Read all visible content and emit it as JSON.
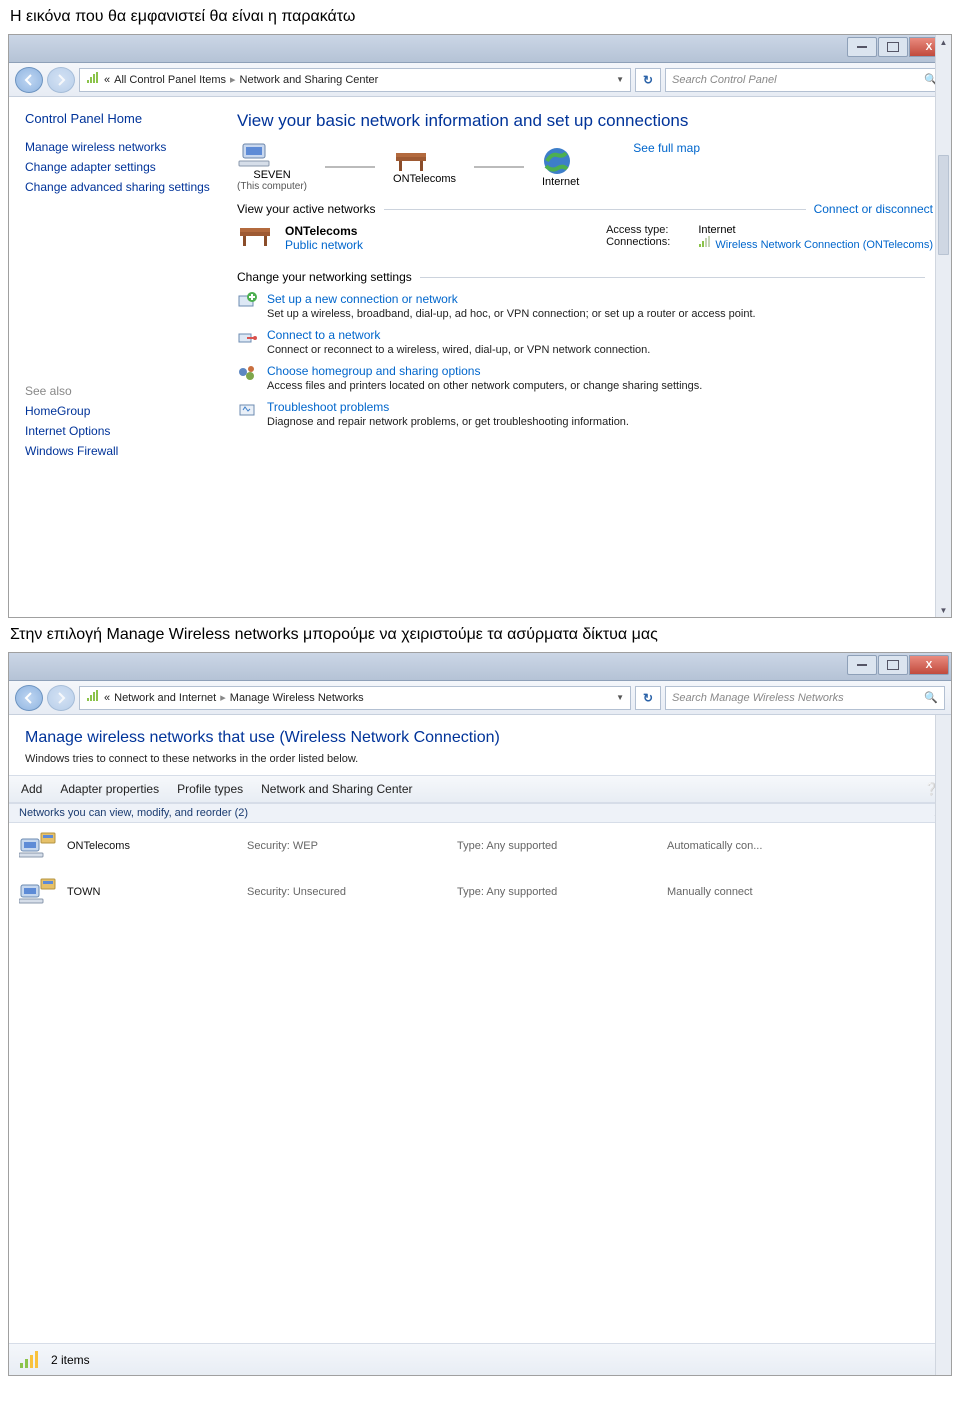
{
  "doc": {
    "intro": "Η εικόνα που θα εμφανιστεί θα είναι η παρακάτω",
    "middle": "Στην επιλογή Manage Wireless networks μπορούμε να χειριστούμε τα ασύρματα δίκτυα μας"
  },
  "win1": {
    "breadcrumb": {
      "pre": "«",
      "seg1": "All Control Panel Items",
      "seg2": "Network and Sharing Center"
    },
    "search_placeholder": "Search Control Panel",
    "sidebar": {
      "home": "Control Panel Home",
      "links": [
        "Manage wireless networks",
        "Change adapter settings",
        "Change advanced sharing settings"
      ],
      "seealso_label": "See also",
      "seealso": [
        "HomeGroup",
        "Internet Options",
        "Windows Firewall"
      ]
    },
    "heading": "View your basic network information and set up connections",
    "see_full_map": "See full map",
    "map": {
      "node1": "SEVEN",
      "node1_sub": "(This computer)",
      "node2": "ONTelecoms",
      "node3": "Internet"
    },
    "active_label": "View your active networks",
    "connect_disconnect": "Connect or disconnect",
    "active": {
      "name": "ONTelecoms",
      "type": "Public network",
      "access_label": "Access type:",
      "access_value": "Internet",
      "conn_label": "Connections:",
      "conn_value": "Wireless Network Connection (ONTelecoms)"
    },
    "change_label": "Change your networking settings",
    "tasks": [
      {
        "title": "Set up a new connection or network",
        "desc": "Set up a wireless, broadband, dial-up, ad hoc, or VPN connection; or set up a router or access point."
      },
      {
        "title": "Connect to a network",
        "desc": "Connect or reconnect to a wireless, wired, dial-up, or VPN network connection."
      },
      {
        "title": "Choose homegroup and sharing options",
        "desc": "Access files and printers located on other network computers, or change sharing settings."
      },
      {
        "title": "Troubleshoot problems",
        "desc": "Diagnose and repair network problems, or get troubleshooting information."
      }
    ]
  },
  "win2": {
    "breadcrumb": {
      "pre": "«",
      "seg1": "Network and Internet",
      "seg2": "Manage Wireless Networks"
    },
    "search_placeholder": "Search Manage Wireless Networks",
    "heading": "Manage wireless networks that use (Wireless Network Connection)",
    "subheading": "Windows tries to connect to these networks in the order listed below.",
    "toolbar": [
      "Add",
      "Adapter properties",
      "Profile types",
      "Network and Sharing Center"
    ],
    "group_header": "Networks you can view, modify, and reorder (2)",
    "rows": [
      {
        "name": "ONTelecoms",
        "sec": "Security: WEP",
        "type": "Type: Any supported",
        "conn": "Automatically con..."
      },
      {
        "name": "TOWN",
        "sec": "Security: Unsecured",
        "type": "Type: Any supported",
        "conn": "Manually connect"
      }
    ],
    "status": "2 items"
  }
}
